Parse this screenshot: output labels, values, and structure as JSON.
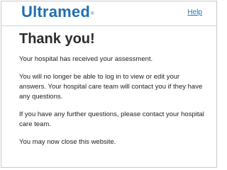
{
  "header": {
    "logo_text": "Ultramed",
    "logo_mark": "®",
    "help_label": "Help"
  },
  "main": {
    "title": "Thank you!",
    "paragraphs": [
      "Your hospital has received your assessment.",
      "You will no longer be able to log in to view or edit your answers. Your hospital care team will contact you if they have any questions.",
      "If you have any further questions, please contact your hospital care team.",
      "You may now close this website."
    ]
  },
  "colors": {
    "brand": "#1f6fb0",
    "text": "#222222",
    "border": "#c9c9c9"
  }
}
